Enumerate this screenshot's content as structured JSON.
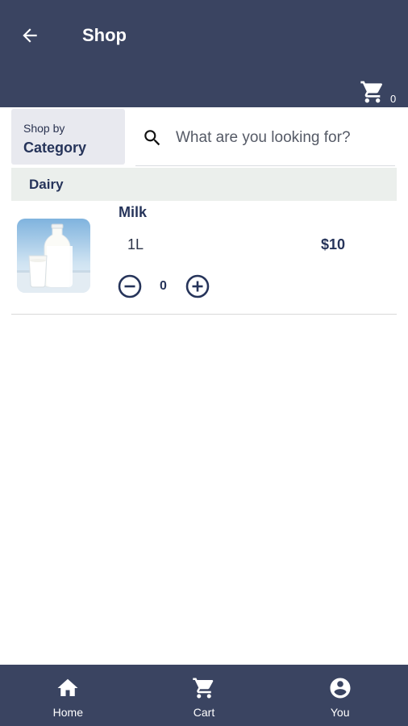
{
  "header": {
    "title": "Shop",
    "back_icon": "arrow-left-icon",
    "cart_icon": "cart-icon",
    "cart_count": "0",
    "background_color": "#3a4461"
  },
  "category_selector": {
    "sub_label": "Shop by",
    "main_label": "Category"
  },
  "search": {
    "placeholder": "What are you looking for?",
    "value": "",
    "icon": "search-icon"
  },
  "sections": [
    {
      "title": "Dairy",
      "products": [
        {
          "name": "Milk",
          "size": "1L",
          "price": "$10",
          "quantity": "0",
          "image": "milk-bottle-and-glass"
        }
      ]
    }
  ],
  "bottom_nav": {
    "items": [
      {
        "label": "Home",
        "icon": "home-icon"
      },
      {
        "label": "Cart",
        "icon": "cart-icon"
      },
      {
        "label": "You",
        "icon": "account-circle-icon"
      }
    ]
  }
}
